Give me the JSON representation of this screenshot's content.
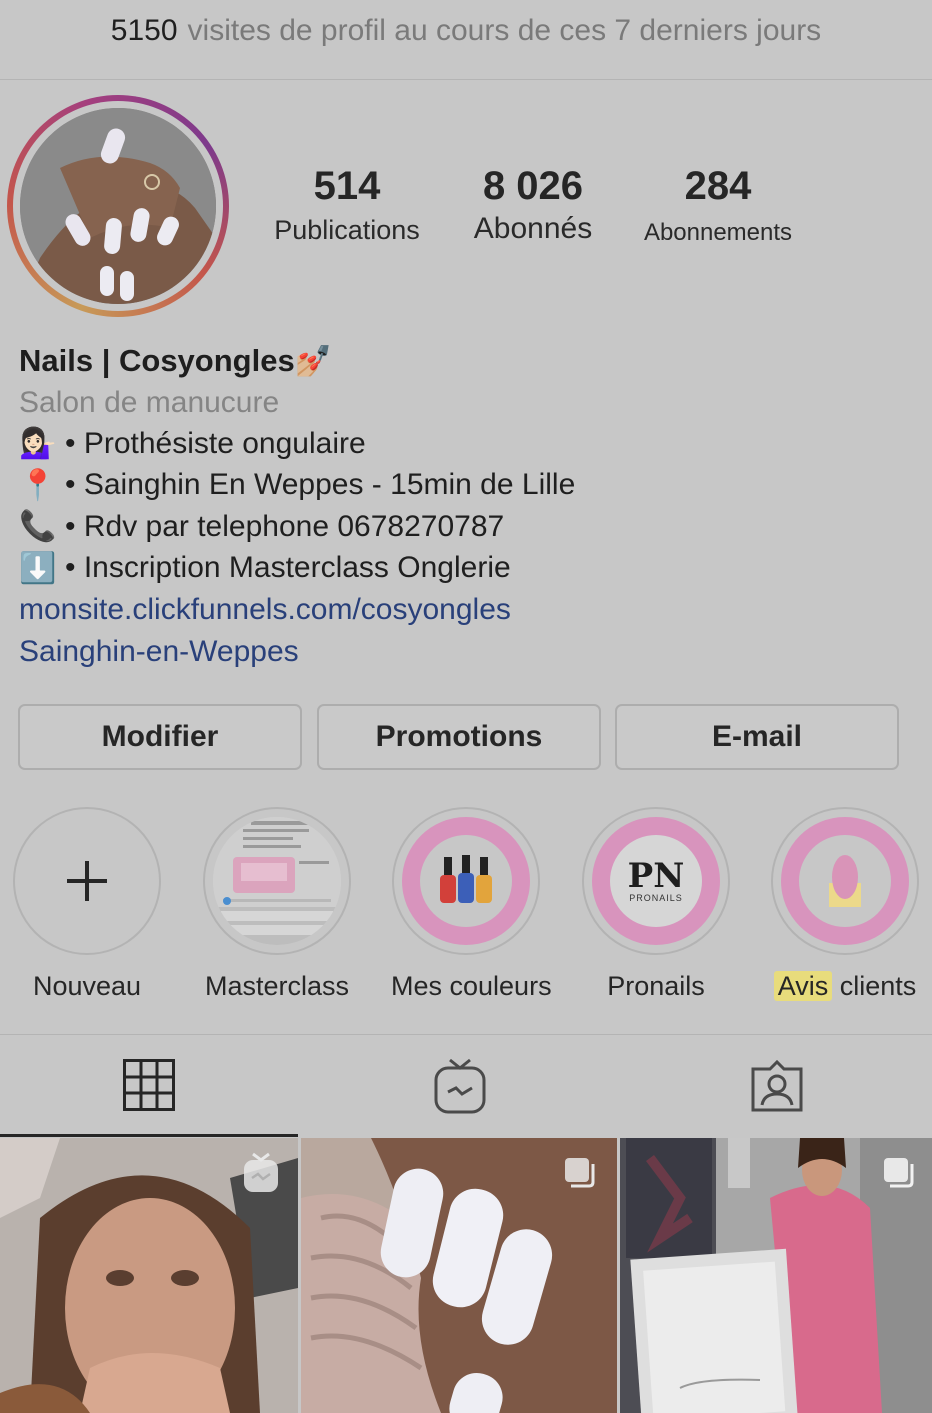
{
  "visits": {
    "count": "5150",
    "text": "visites de profil au cours de ces 7 derniers jours"
  },
  "stats": [
    {
      "value": "514",
      "label": "Publications"
    },
    {
      "value": "8 026",
      "label": "Abonnés"
    },
    {
      "value": "284",
      "label": "Abonnements"
    }
  ],
  "bio": {
    "name": "Nails | Cosyongles",
    "name_emoji": "💅🏼",
    "category": "Salon de manucure",
    "lines": [
      {
        "emoji": "💁🏻‍♀️",
        "text": "• Prothésiste ongulaire"
      },
      {
        "emoji": "📍",
        "text": "• Sainghin En Weppes - 15min de Lille"
      },
      {
        "emoji": "📞",
        "text": "• Rdv par telephone 0678270787"
      },
      {
        "emoji": "⬇️",
        "text": "• Inscription Masterclass Onglerie"
      }
    ],
    "link": "monsite.clickfunnels.com/cosyongles",
    "location": "Sainghin-en-Weppes"
  },
  "buttons": {
    "edit": "Modifier",
    "promotions": "Promotions",
    "email": "E-mail"
  },
  "highlights": [
    {
      "label": "Nouveau"
    },
    {
      "label": "Masterclass"
    },
    {
      "label": "Mes couleurs"
    },
    {
      "label": "Pronails",
      "logo": "PN",
      "sub": "PRONAILS"
    },
    {
      "label_a": "Avis",
      "label_b": "clients"
    }
  ],
  "tabs": [
    "grid-icon",
    "igtv-icon",
    "tagged-icon"
  ],
  "colors": {
    "link": "#29407a",
    "highlight_pink": "#d894bd",
    "background": "#c7c7c7"
  }
}
